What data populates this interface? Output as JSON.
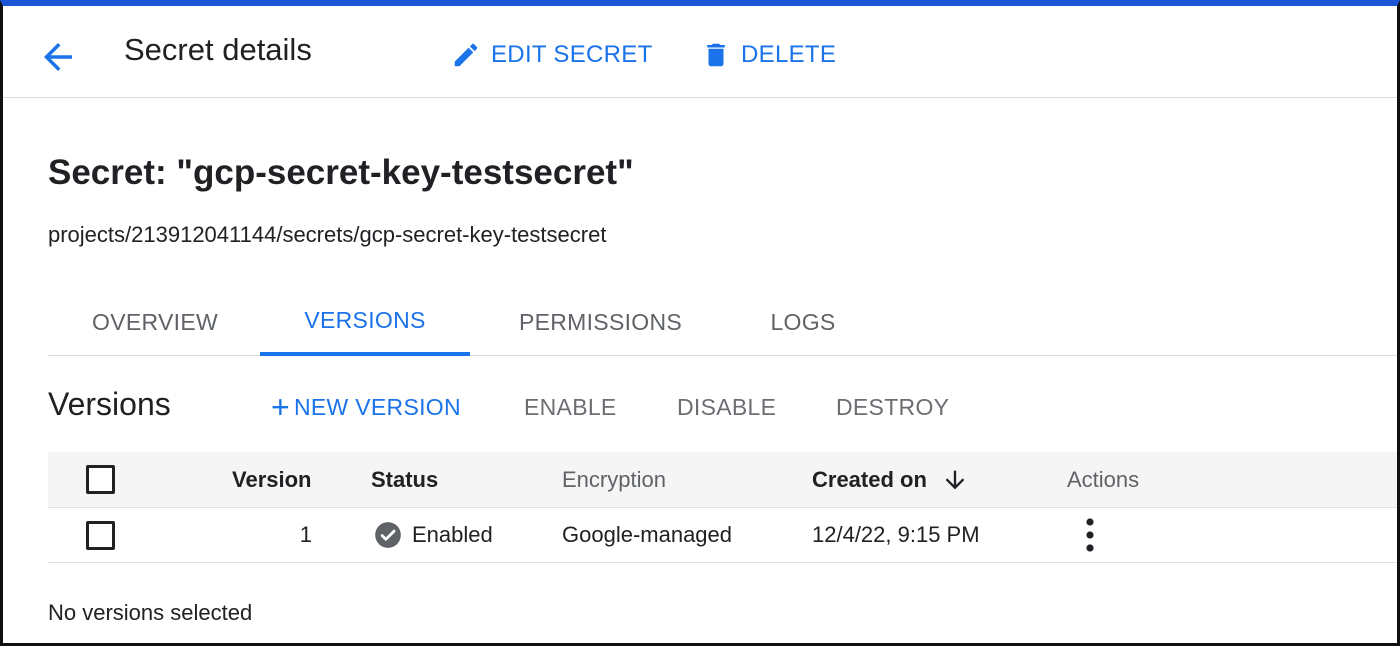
{
  "header": {
    "title": "Secret details",
    "edit_label": "EDIT SECRET",
    "delete_label": "DELETE"
  },
  "secret": {
    "title": "Secret: \"gcp-secret-key-testsecret\"",
    "path": "projects/213912041144/secrets/gcp-secret-key-testsecret"
  },
  "tabs": [
    {
      "label": "OVERVIEW",
      "active": false
    },
    {
      "label": "VERSIONS",
      "active": true
    },
    {
      "label": "PERMISSIONS",
      "active": false
    },
    {
      "label": "LOGS",
      "active": false
    }
  ],
  "versions": {
    "title": "Versions",
    "toolbar": {
      "new_version": "NEW VERSION",
      "enable": "ENABLE",
      "disable": "DISABLE",
      "destroy": "DESTROY"
    },
    "columns": {
      "version": "Version",
      "status": "Status",
      "encryption": "Encryption",
      "created_on": "Created on",
      "actions": "Actions"
    },
    "rows": [
      {
        "version": "1",
        "status": "Enabled",
        "encryption": "Google-managed",
        "created_on": "12/4/22, 9:15 PM"
      }
    ],
    "selection_status": "No versions selected"
  },
  "icons": {
    "back": "arrow-back-icon",
    "edit": "pencil-icon",
    "delete": "trash-icon",
    "add": "plus-icon",
    "sort": "arrow-down-icon",
    "status": "check-circle-icon",
    "more": "more-vert-icon"
  },
  "colors": {
    "accent": "#1a73e8",
    "frame_top": "#1a56d6",
    "text": "#202124",
    "muted": "#5f6368",
    "status_icon": "#5f6368"
  }
}
